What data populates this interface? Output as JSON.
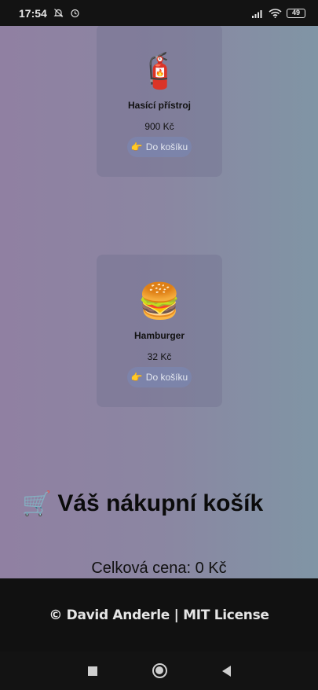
{
  "status_bar": {
    "time": "17:54",
    "battery": "49",
    "icons": [
      "mute-bell-icon",
      "alarm-icon",
      "signal-icon",
      "wifi-icon",
      "battery-icon"
    ]
  },
  "products": [
    {
      "icon": "🧯",
      "icon_name": "fire-extinguisher-icon",
      "name": "Hasící přístroj",
      "price": "900 Kč",
      "button": "Do košíku"
    },
    {
      "icon": "🍔",
      "icon_name": "hamburger-icon",
      "name": "Hamburger",
      "price": "32 Kč",
      "button": "Do košíku"
    }
  ],
  "button_icon": "👉",
  "cart": {
    "icon": "🛒",
    "title": "Váš nákupní košík",
    "total": "Celková cena: 0 Kč"
  },
  "footer": {
    "text": "© David Anderle | MIT License"
  },
  "colors": {
    "gradient_left": "#9080a2",
    "gradient_right": "#8095a5",
    "footer_bg": "#111111"
  }
}
